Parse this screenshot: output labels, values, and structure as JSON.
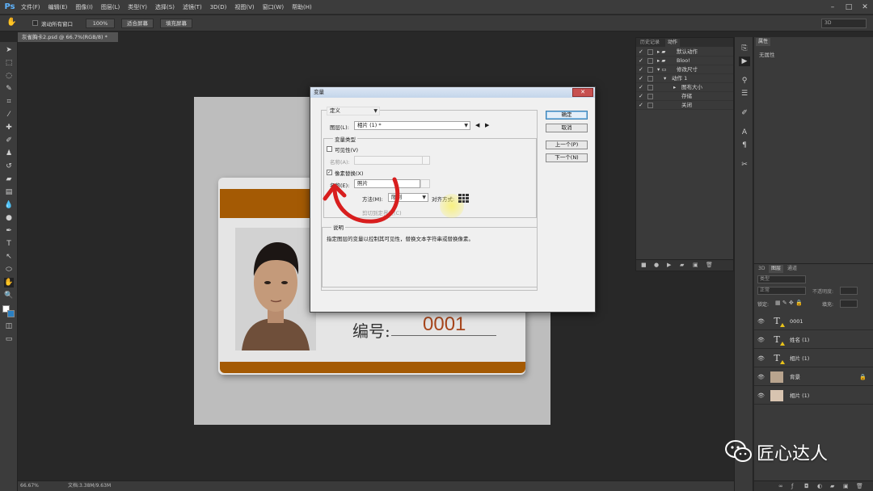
{
  "app": {
    "logo": "Ps"
  },
  "menu": [
    "文件(F)",
    "编辑(E)",
    "图像(I)",
    "图层(L)",
    "类型(Y)",
    "选择(S)",
    "滤镜(T)",
    "3D(D)",
    "视图(V)",
    "窗口(W)",
    "帮助(H)"
  ],
  "window_controls": [
    "–",
    "□",
    "✕"
  ],
  "options": {
    "scroll_all": "滚动所有窗口",
    "zoom": "100%",
    "fit_screen": "适合屏幕",
    "fill_screen": "填充屏幕",
    "mode_3d": "3D"
  },
  "document": {
    "tab_title": "灰雀胸卡2.psd @ 66.7%(RGB/8) *"
  },
  "card": {
    "id_label": "编号:",
    "id_number": "0001"
  },
  "dialog": {
    "title": "变量",
    "close": "✕",
    "define_select": "定义",
    "layer_label": "图层(L):",
    "layer_value": "相片 (1) *",
    "nav_prev": "◀",
    "nav_next": "▶",
    "var_type_group": "变量类型",
    "visibility_label": "可见性(V)",
    "visibility_checked": false,
    "name_a_label": "名称(A):",
    "pixel_replace_label": "像素替换(X)",
    "pixel_replace_checked": true,
    "name_e_label": "名称(E):",
    "name_e_value": "照片",
    "method_label": "方法(M):",
    "method_value": "限制",
    "align_label": "对齐方式:",
    "clip_label": "剪切到定界框(C)",
    "description_group": "说明",
    "description_text": "指定图层的变量以控制其可见性，替换文本字符串或替换像素。",
    "buttons": {
      "ok": "确定",
      "cancel": "取消",
      "prev": "上一个(P)",
      "next": "下一个(N)"
    }
  },
  "actions_panel": {
    "tabs": [
      "历史记录",
      "动作"
    ],
    "rows": [
      {
        "label": "默认动作",
        "level": 0
      },
      {
        "label": "Bloo!",
        "level": 0
      },
      {
        "label": "修改尺寸",
        "level": 0
      },
      {
        "label": "动作 1",
        "level": 1
      },
      {
        "label": "图布大小",
        "level": 2
      },
      {
        "label": "存储",
        "level": 2
      },
      {
        "label": "关闭",
        "level": 2
      }
    ]
  },
  "properties_panel": {
    "tab": "属性",
    "empty_text": "无属性"
  },
  "layers_panel": {
    "tabs": [
      "3D",
      "图层",
      "通道"
    ],
    "kind_filter": "类型",
    "blend_mode": "正常",
    "opacity_label": "不透明度:",
    "lock_label": "锁定:",
    "fill_label": "填充:",
    "layers": [
      {
        "name": "0001",
        "kind": "text"
      },
      {
        "name": "姓名 (1)",
        "kind": "text"
      },
      {
        "name": "相片 (1)",
        "kind": "text"
      },
      {
        "name": "背景",
        "kind": "image",
        "locked": true
      },
      {
        "name": "相片 (1)",
        "kind": "image"
      }
    ]
  },
  "status": {
    "zoom": "66.67%",
    "doc_info": "文档:3.38M/9.63M"
  },
  "watermark": {
    "text": "匠心达人",
    "icon": "wechat-icon"
  },
  "colors": {
    "accent_brown": "#a45a04",
    "id_number": "#a8461c",
    "annotation_red": "#d81e1e"
  }
}
